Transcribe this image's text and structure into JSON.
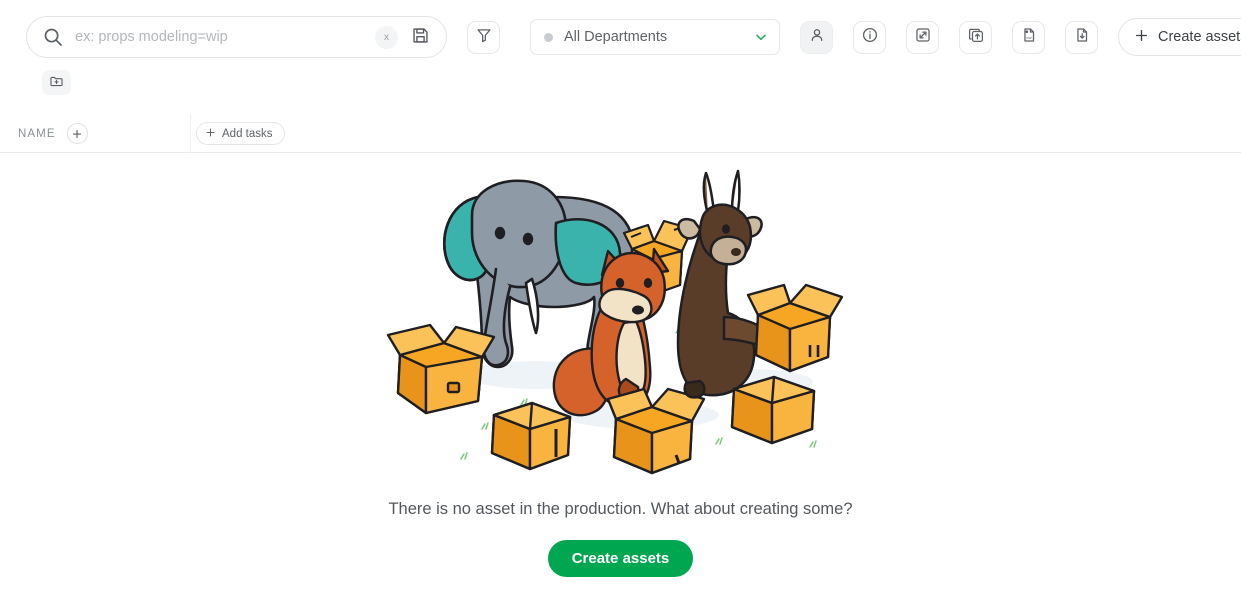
{
  "toolbar": {
    "search": {
      "icon": "search-icon",
      "placeholder": "ex: props modeling=wip",
      "value": "",
      "clear_label": "x",
      "save_icon": "floppy-disk-save-icon"
    },
    "filter_icon": "funnel-filter-icon",
    "departments": {
      "label": "All Departments",
      "dot_color": "#c8ccd0",
      "chevron_icon": "chevron-down-icon",
      "chevron_color": "#27ae60"
    },
    "icons": [
      {
        "name": "person-icon",
        "active": true
      },
      {
        "name": "info-circle-icon",
        "active": false
      },
      {
        "name": "expand-arrows-icon",
        "active": false
      },
      {
        "name": "upload-stack-icon",
        "active": false
      },
      {
        "name": "csv-import-icon",
        "active": false
      },
      {
        "name": "file-download-icon",
        "active": false
      }
    ],
    "create_assets_label": "Create assets",
    "create_assets_icon": "plus-icon"
  },
  "subbar": {
    "folder_icon": "folder-plus-icon"
  },
  "table": {
    "name_column_label": "NAME",
    "name_add_icon": "plus-icon",
    "add_tasks_label": "Add tasks",
    "add_tasks_icon": "plus-icon"
  },
  "empty_state": {
    "illustration": "animals-packing-boxes-illustration",
    "message": "There is no asset in the production. What about creating some?",
    "button_label": "Create assets",
    "button_color": "#00a650"
  }
}
